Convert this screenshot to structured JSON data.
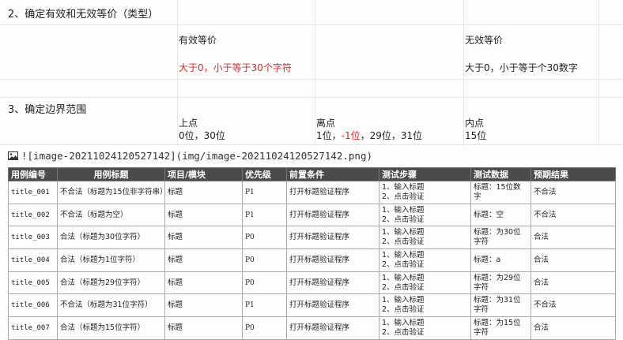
{
  "section2": {
    "heading": "2、确定有效和无效等价（类型）",
    "valid_header": "有效等价",
    "invalid_header": "无效等价",
    "valid_value": "大于0，小于等于30个字符",
    "invalid_value": "大于0，小于等于个30数字"
  },
  "section3": {
    "heading": "3、确定边界范围",
    "upper_header": "上点",
    "off_header": "离点",
    "inner_header": "内点",
    "upper_value": "0位，30位",
    "off_value_a": "1位，",
    "off_value_red": "-1位",
    "off_value_b": "，29位，31位",
    "inner_value": "15位"
  },
  "image_ref": {
    "icon": "image-icon",
    "text": "![image-20211024120527142](img/image-20211024120527142.png)"
  },
  "table": {
    "headers": [
      "用例编号",
      "用例标题",
      "项目/模块",
      "优先级",
      "前置条件",
      "测试步骤",
      "测试数据",
      "预期结果"
    ],
    "rows": [
      {
        "id": "title_001",
        "title": "不合法（标题为15位非字符串）",
        "module": "标题",
        "priority": "P1",
        "precondition": "打开标题验证程序",
        "step1": "1、输入标题",
        "step2": "2、点击验证",
        "data": "标题：15位数字",
        "expected": "不合法"
      },
      {
        "id": "title_002",
        "title": "不合法（标题为空）",
        "module": "标题",
        "priority": "P1",
        "precondition": "打开标题验证程序",
        "step1": "1、输入标题",
        "step2": "2、点击验证",
        "data": "标题：空",
        "expected": "不合法"
      },
      {
        "id": "title_003",
        "title": "合法（标题为30位字符）",
        "module": "标题",
        "priority": "P0",
        "precondition": "打开标题验证程序",
        "step1": "1、输入标题",
        "step2": "2、点击验证",
        "data": "标题：为30位字符",
        "expected": "合法"
      },
      {
        "id": "title_004",
        "title": "合法（标题为1位字符）",
        "module": "标题",
        "priority": "P0",
        "precondition": "打开标题验证程序",
        "step1": "1、输入标题",
        "step2": "2、点击验证",
        "data": "标题：a",
        "expected": "合法"
      },
      {
        "id": "title_005",
        "title": "合法（标题为29位字符）",
        "module": "标题",
        "priority": "P0",
        "precondition": "打开标题验证程序",
        "step1": "1、输入标题",
        "step2": "2、点击验证",
        "data": "标题：为29位字符",
        "expected": "合法"
      },
      {
        "id": "title_006",
        "title": "不合法（标题为31位字符）",
        "module": "标题",
        "priority": "P1",
        "precondition": "打开标题验证程序",
        "step1": "1、输入标题",
        "step2": "2、点击验证",
        "data": "标题：为31位字符",
        "expected": "不合法"
      },
      {
        "id": "title_007",
        "title": "合法（标题为15位字符）",
        "module": "标题",
        "priority": "P0",
        "precondition": "打开标题验证程序",
        "step1": "1、输入标题",
        "step2": "2、点击验证",
        "data": "标题：为15位字符",
        "expected": "合法"
      }
    ]
  }
}
